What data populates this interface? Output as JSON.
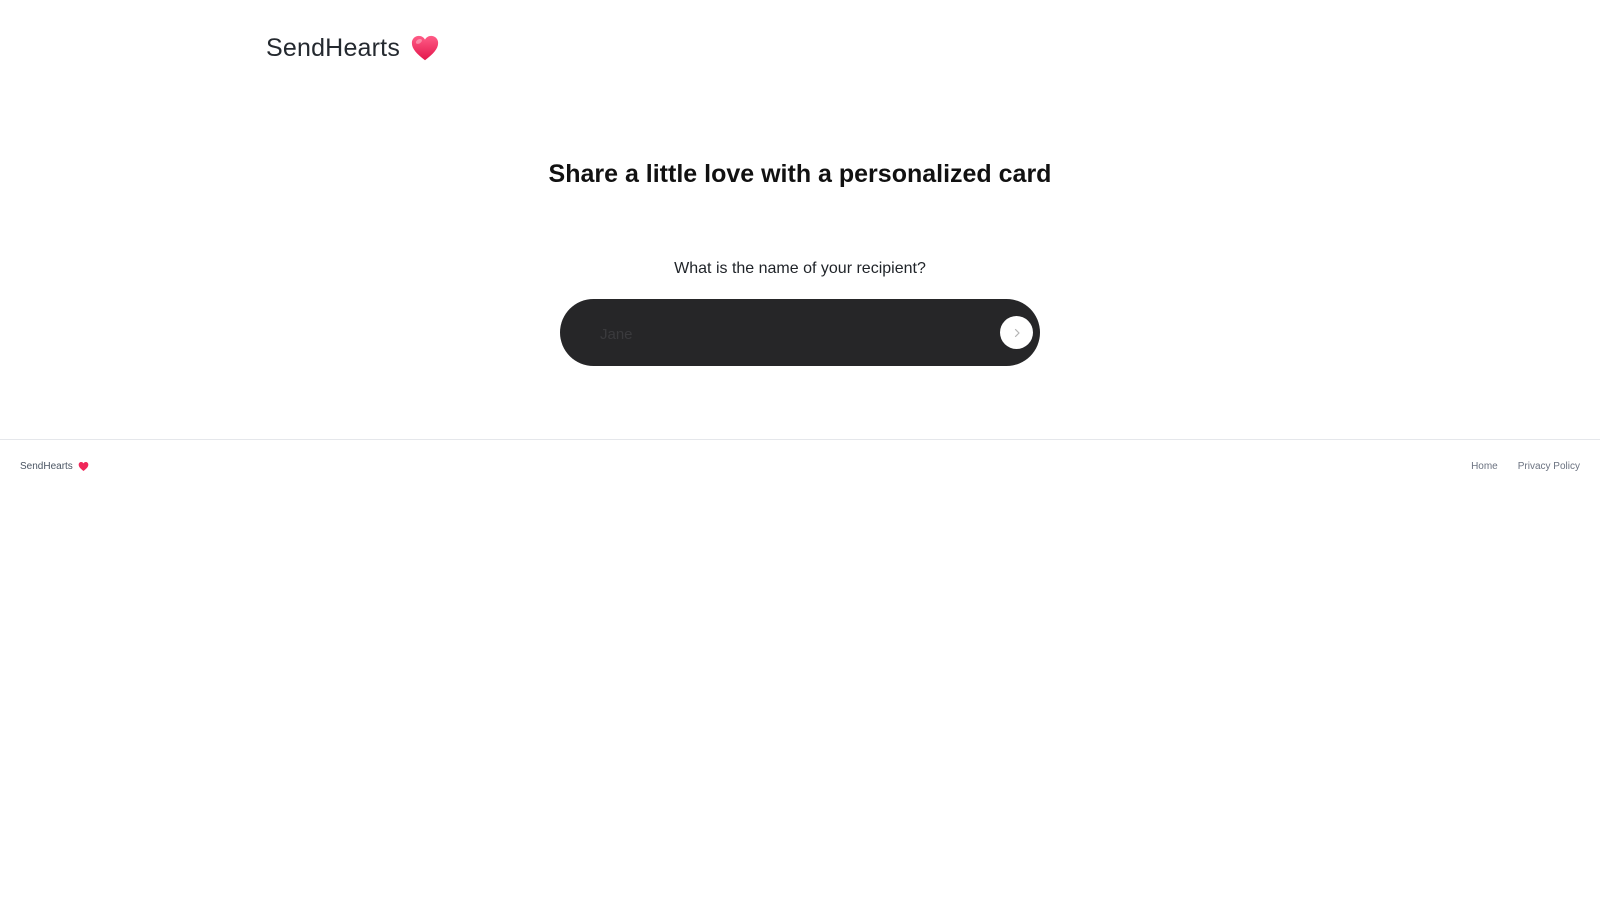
{
  "header": {
    "brand": "SendHearts",
    "brand_icon": "heart-icon"
  },
  "main": {
    "title": "Share a little love with a personalized card",
    "question": "What is the name of your recipient?",
    "name_input": {
      "value": "",
      "placeholder": "Jane"
    },
    "submit_icon": "chevron-right-icon"
  },
  "footer": {
    "brand": "SendHearts",
    "brand_icon": "heart-icon",
    "links": [
      {
        "label": "Home"
      },
      {
        "label": "Privacy Policy"
      }
    ]
  },
  "colors": {
    "heart": "#f0285a",
    "input_background": "#262628",
    "footer_link": "#6b7280"
  }
}
